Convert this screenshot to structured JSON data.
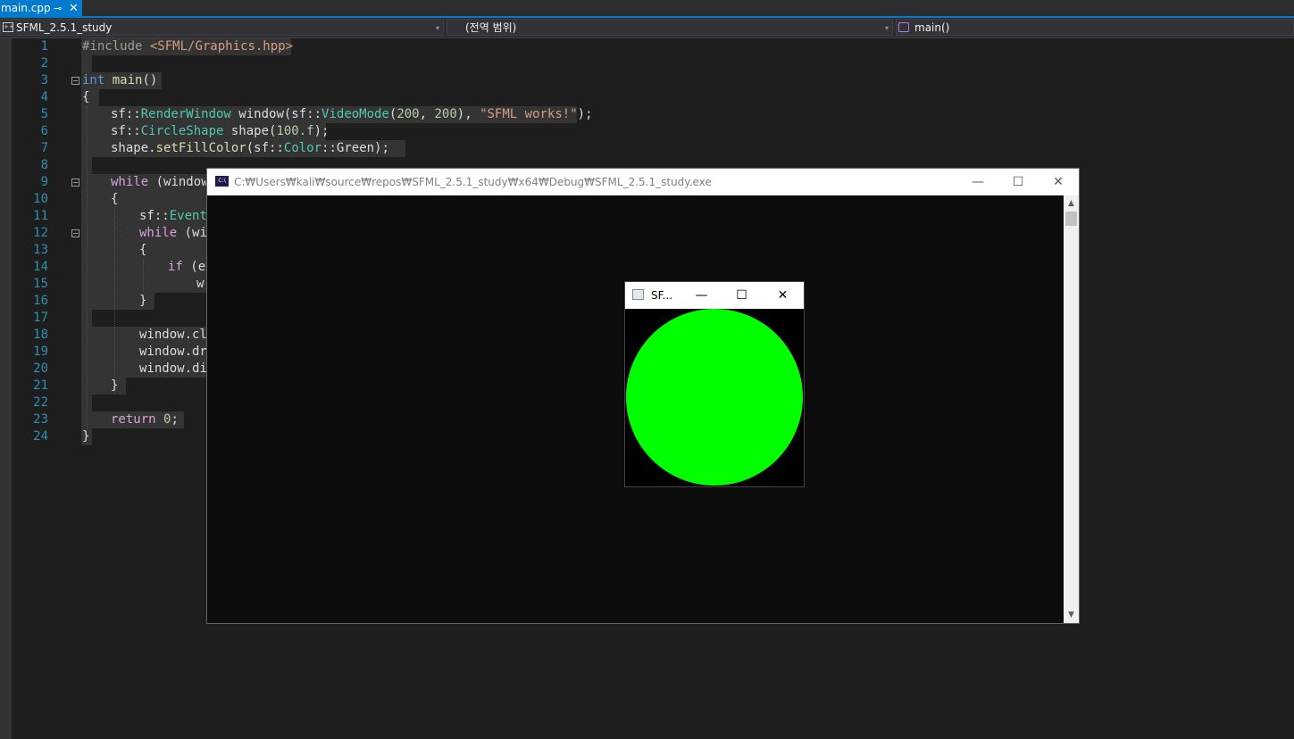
{
  "tab": {
    "filename": "main.cpp",
    "pin_icon": "pin-icon",
    "close_icon": "close-icon",
    "pin_glyph": "⊸",
    "close_glyph": "✕"
  },
  "navbar": {
    "project": "SFML_2.5.1_study",
    "scope": "(전역 범위)",
    "member": "main()",
    "dropdown_arrow": "▾"
  },
  "editor": {
    "line_numbers": [
      "1",
      "2",
      "3",
      "4",
      "5",
      "6",
      "7",
      "8",
      "9",
      "10",
      "11",
      "12",
      "13",
      "14",
      "15",
      "16",
      "17",
      "18",
      "19",
      "20",
      "21",
      "22",
      "23",
      "24"
    ]
  },
  "console": {
    "title": "C:₩Users₩kali₩source₩repos₩SFML_2.5.1_study₩x64₩Debug₩SFML_2.5.1_study.exe",
    "icon_text": "C:\\",
    "minimize": "—",
    "maximize": "☐",
    "close": "✕",
    "scroll_up": "▲",
    "scroll_down": "▼"
  },
  "sfml_window": {
    "title": "SF...",
    "minimize": "—",
    "maximize": "☐",
    "close": "✕",
    "shape_color": "#00ff00"
  },
  "colors": {
    "accent": "#007acc",
    "editor_bg": "#1e1e1e",
    "line_number": "#2b91af"
  }
}
